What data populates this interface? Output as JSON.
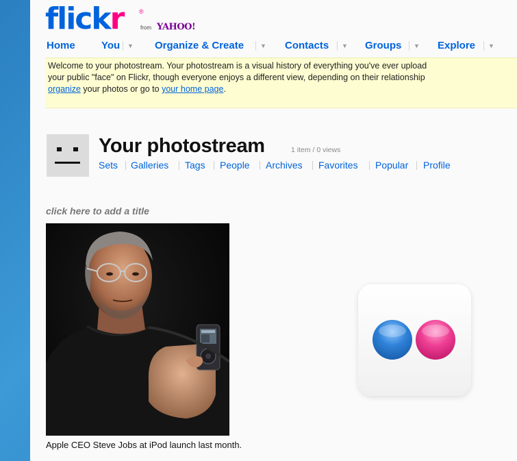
{
  "logo": {
    "wordmark_main": "flick",
    "wordmark_r": "r",
    "reg": "®",
    "from": "from",
    "yahoo": "YAHOO!"
  },
  "nav": {
    "items": [
      {
        "label": "Home",
        "dropdown": false
      },
      {
        "label": "You",
        "dropdown": true
      },
      {
        "label": "Organize & Create",
        "dropdown": true
      },
      {
        "label": "Contacts",
        "dropdown": true
      },
      {
        "label": "Groups",
        "dropdown": true
      },
      {
        "label": "Explore",
        "dropdown": true
      }
    ]
  },
  "welcome": {
    "line1": "Welcome to your photostream. Your photostream is a visual history of everything you've ever upload",
    "line2": "your public \"face\" on Flickr, though everyone enjoys a different view, depending on their relationship",
    "organize_link": "organize",
    "line3_mid": " your photos or go to ",
    "home_link": "your home page",
    "line3_end": "."
  },
  "photostream": {
    "title": "Your photostream",
    "meta": "1 item / 0 views",
    "subnav": [
      "Sets",
      "Galleries",
      "Tags",
      "People",
      "Archives",
      "Favorites",
      "Popular",
      "Profile"
    ]
  },
  "set": {
    "add_title_prompt": "click here to add a title",
    "photo_caption": "Apple CEO Steve Jobs at iPod launch last month."
  },
  "colors": {
    "flickr_blue": "#0063dc",
    "flickr_pink": "#ff0084",
    "welcome_bg": "#fefdd2"
  }
}
